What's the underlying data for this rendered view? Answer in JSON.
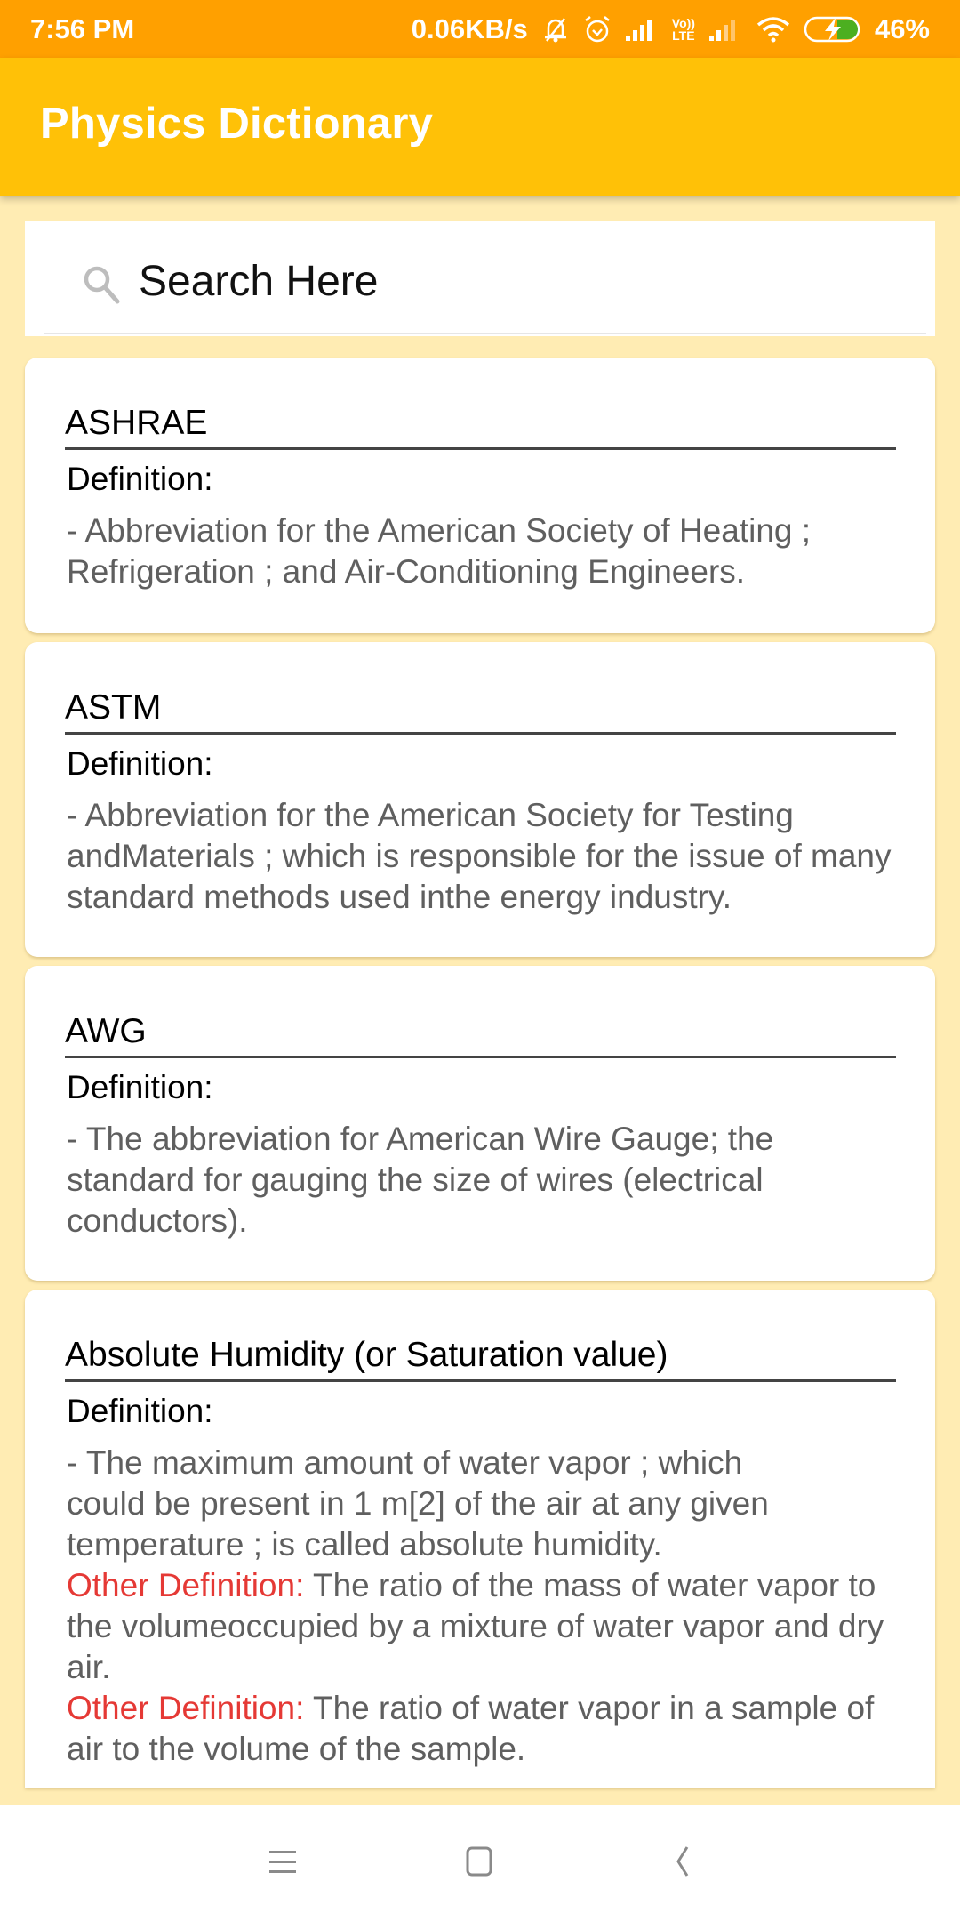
{
  "status_bar": {
    "time": "7:56 PM",
    "network_speed": "0.06KB/s",
    "battery_percent": "46%",
    "icons": [
      "mute-bell-icon",
      "alarm-icon",
      "signal-icon",
      "volte-icon",
      "signal-weak-icon",
      "wifi-icon",
      "battery-charging-icon"
    ],
    "volte_label_top": "Vo))",
    "volte_label_bottom": "LTE",
    "battery_level": 0.46
  },
  "app_bar": {
    "title": "Physics Dictionary"
  },
  "search": {
    "placeholder": "Search Here",
    "value": "",
    "icon": "search-icon"
  },
  "entries": [
    {
      "term": "ASHRAE",
      "definition_label": "Definition:",
      "definition": "- Abbreviation for the American Society of Heating ; Refrigeration ; and Air-Conditioning Engineers.",
      "other_definitions": []
    },
    {
      "term": "ASTM",
      "definition_label": "Definition:",
      "definition": "- Abbreviation for the American Society for Testing andMaterials ; which is responsible for the issue of many standard methods used inthe energy industry.",
      "other_definitions": []
    },
    {
      "term": "AWG",
      "definition_label": "Definition:",
      "definition": "- The abbreviation for American Wire Gauge; the standard for gauging the size of wires (electrical conductors).",
      "other_definitions": []
    },
    {
      "term": "Absolute Humidity (or Saturation value)",
      "definition_label": "Definition:",
      "definition": "- The maximum amount of water vapor ; which could be present in 1 m[2] of the air at any given temperature ; is called absolute humidity.",
      "other_definitions": [
        {
          "label": "Other Definition:",
          "text": " The ratio of the mass of water vapor to the volumeoccupied by a mixture of water vapor and dry air."
        },
        {
          "label": "Other Definition:",
          "text": " The ratio of water vapor in a sample of air to the volume of the sample."
        }
      ]
    }
  ],
  "nav_bar": {
    "buttons": [
      "menu-icon",
      "home-icon",
      "back-icon"
    ]
  },
  "colors": {
    "status_bar": "#FFA000",
    "app_bar": "#FFC107",
    "background": "#FFECB3",
    "other_definition_label": "#E53935",
    "definition_text": "#5F5F5F"
  }
}
